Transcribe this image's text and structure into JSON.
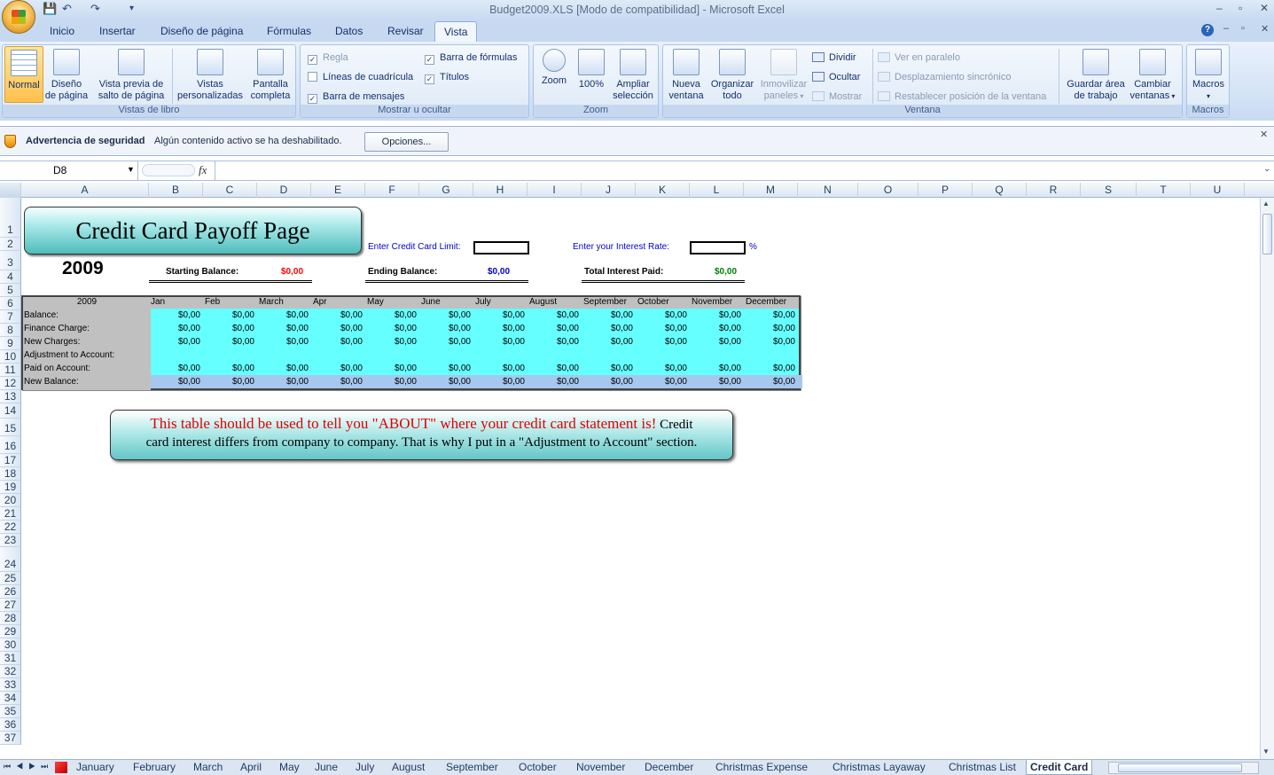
{
  "window": {
    "title": "Budget2009.XLS  [Modo de compatibilidad]  -  Microsoft Excel",
    "min": "–",
    "max": "▫",
    "close": "✕"
  },
  "ribbon_tabs": [
    "Inicio",
    "Insertar",
    "Diseño de página",
    "Fórmulas",
    "Datos",
    "Revisar",
    "Vista"
  ],
  "active_tab": "Vista",
  "ribbon": {
    "vistas_libro": {
      "title": "Vistas de libro",
      "normal": "Normal",
      "diseno_1": "Diseño",
      "diseno_2": "de página",
      "vista_previa_1": "Vista previa de",
      "vista_previa_2": "salto de página",
      "vistas_pers_1": "Vistas",
      "vistas_pers_2": "personalizadas",
      "pantalla_1": "Pantalla",
      "pantalla_2": "completa"
    },
    "mostrar": {
      "title": "Mostrar u ocultar",
      "regla": "Regla",
      "lineas": "Líneas de cuadrícula",
      "barra_mensajes": "Barra de mensajes",
      "barra_formulas": "Barra de fórmulas",
      "titulos": "Títulos"
    },
    "zoom": {
      "title": "Zoom",
      "zoom": "Zoom",
      "cien": "100%",
      "ampliar_1": "Ampliar",
      "ampliar_2": "selección"
    },
    "ventana": {
      "title": "Ventana",
      "nueva_1": "Nueva",
      "nueva_2": "ventana",
      "organizar_1": "Organizar",
      "organizar_2": "todo",
      "inmovilizar_1": "Inmovilizar",
      "inmovilizar_2": "paneles",
      "dividir": "Dividir",
      "ocultar": "Ocultar",
      "mostrar": "Mostrar",
      "paralelo": "Ver en paralelo",
      "desplazamiento": "Desplazamiento sincrónico",
      "restablecer": "Restablecer posición de la ventana",
      "guardar_1": "Guardar área",
      "guardar_2": "de trabajo",
      "cambiar_1": "Cambiar",
      "cambiar_2": "ventanas"
    },
    "macros": {
      "title": "Macros",
      "macros": "Macros"
    }
  },
  "security_bar": {
    "label": "Advertencia de seguridad",
    "message": "Algún contenido activo se ha deshabilitado.",
    "button": "Opciones..."
  },
  "formula_bar": {
    "name_box": "D8",
    "fx": "fx",
    "value": ""
  },
  "columns": [
    "A",
    "B",
    "C",
    "D",
    "E",
    "F",
    "G",
    "H",
    "I",
    "J",
    "K",
    "L",
    "M",
    "N",
    "O",
    "P",
    "Q",
    "R",
    "S",
    "T",
    "U"
  ],
  "rows": [
    "1",
    "2",
    "3",
    "4",
    "5",
    "6",
    "7",
    "8",
    "9",
    "10",
    "11",
    "12",
    "13",
    "14",
    "15",
    "16",
    "17",
    "18",
    "19",
    "20",
    "21",
    "22",
    "23",
    "24",
    "25",
    "26",
    "27",
    "28",
    "29",
    "30",
    "31",
    "32",
    "33",
    "34",
    "35",
    "36",
    "37"
  ],
  "sheet": {
    "banner_title": "Credit Card Payoff Page",
    "year": "2009",
    "limit_label": "Enter Credit Card Limit:",
    "rate_label": "Enter your Interest Rate:",
    "rate_unit": "%",
    "starting_label": "Starting Balance:",
    "starting_value": "$0,00",
    "ending_label": "Ending Balance:",
    "ending_value": "$0,00",
    "interest_label": "Total Interest Paid:",
    "interest_value": "$0,00",
    "table_year": "2009",
    "months": [
      "Jan",
      "Feb",
      "March",
      "Apr",
      "May",
      "June",
      "July",
      "August",
      "September",
      "October",
      "November",
      "December"
    ],
    "row_labels": [
      "Balance:",
      "Finance Charge:",
      "New Charges:",
      "Adjustment to Account:",
      "Paid on Account:",
      "New Balance:"
    ],
    "cell_value": "$0,00",
    "note_red": "This table should be used to tell you \"ABOUT\" where your credit card statement is!",
    "note_black_1": " Credit",
    "note_black_2": "card interest differs from company to company. That is why I put in a \"Adjustment to Account\" section."
  },
  "sheet_tabs": [
    "January",
    "February",
    "March",
    "April",
    "May",
    "June",
    "July",
    "August",
    "September",
    "October",
    "November",
    "December",
    "Christmas Expense",
    "Christmas Layaway",
    "Christmas List",
    "Credit Card"
  ],
  "active_sheet": "Credit Card",
  "colors": {
    "cyan": "#66ffff",
    "gray": "#c0c0c0",
    "banner": "#7fd6d6",
    "starting": "#ff0000",
    "ending": "#0000cc",
    "interest": "#008000",
    "label_blue": "#0000cc",
    "note_red": "#e00000"
  }
}
